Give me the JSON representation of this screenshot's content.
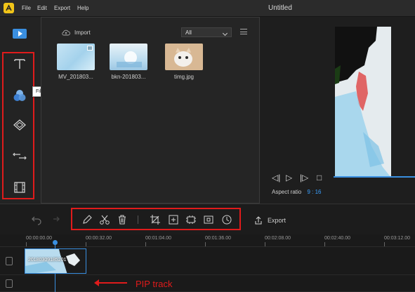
{
  "menu": {
    "file": "File",
    "edit": "Edit",
    "export": "Export",
    "help": "Help"
  },
  "window": {
    "title": "Untitled"
  },
  "library": {
    "import_label": "Import",
    "filter_value": "All",
    "items": [
      {
        "label": "MV_201803..."
      },
      {
        "label": "bkn-201803..."
      },
      {
        "label": "timg.jpg"
      }
    ]
  },
  "sidebar": {
    "tooltip": "Filters",
    "items": [
      "media-icon",
      "text-icon",
      "filters-icon",
      "overlays-icon",
      "transitions-icon",
      "elements-icon"
    ]
  },
  "preview": {
    "aspect_label": "Aspect ratio",
    "aspect_value": "9 : 16"
  },
  "toolbar": {
    "export_label": "Export",
    "tools": [
      "pencil-icon",
      "scissors-icon",
      "trash-icon",
      "crop-icon",
      "zoom-icon",
      "freeze-frame-icon",
      "mosaic-icon",
      "speed-icon"
    ]
  },
  "timeline": {
    "ticks": [
      "00:00:00.00",
      "00:00:32.00",
      "00:01:04.00",
      "00:01:36.00",
      "00:02:08.00",
      "00:02:40.00",
      "00:03:12.00"
    ],
    "clip_label": "20180309185201"
  },
  "annotation": {
    "pip_label": "PIP track"
  },
  "colors": {
    "accent": "#3a8fe0",
    "highlight": "#e01b1b",
    "logo": "#f0c419"
  }
}
